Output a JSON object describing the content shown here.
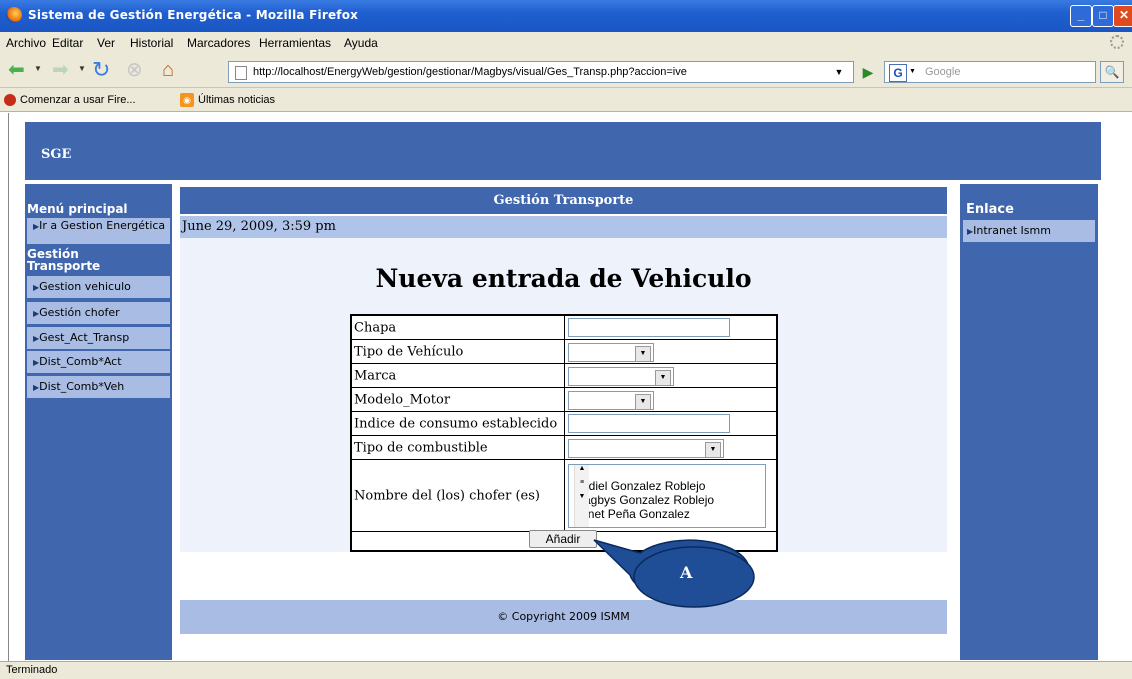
{
  "window": {
    "title": "Sistema de Gestión Energética - Mozilla Firefox"
  },
  "menu": [
    "Archivo",
    "Editar",
    "Ver",
    "Historial",
    "Marcadores",
    "Herramientas",
    "Ayuda"
  ],
  "toolbar": {
    "url": "http://localhost/EnergyWeb/gestion/gestionar/Magbys/visual/Ges_Transp.php?accion=ive",
    "search_placeholder": "Google",
    "search_engine_letter": "G"
  },
  "bookmarks": [
    "Comenzar a usar Fire...",
    "Últimas noticias"
  ],
  "header": {
    "site": "SGE"
  },
  "left_menu": {
    "title": "Menú principal",
    "top_item": "Ir a Gestion Energética",
    "section": "Gestión Transporte",
    "items": [
      "Gestion vehiculo",
      "Gestión chofer",
      "Gest_Act_Transp",
      "Dist_Comb*Act",
      "Dist_Comb*Veh"
    ]
  },
  "center": {
    "title": "Gestión Transporte",
    "date": "June 29, 2009, 3:59 pm",
    "page_title": "Nueva entrada de Vehiculo",
    "form": {
      "labels": [
        "Chapa",
        "Tipo de Vehículo",
        "Marca",
        "Modelo_Motor",
        "Indice de consumo establecido",
        "Tipo de combustible",
        "Nombre del (los) chofer (es)"
      ],
      "chofer_options": [
        "Abdiel Gonzalez Roblejo",
        "Magbys Gonzalez Roblejo",
        "Yanet Peña Gonzalez"
      ],
      "submit": "Añadir"
    },
    "footer": "© Copyright 2009 ISMM"
  },
  "right_menu": {
    "title": "Enlace",
    "items": [
      "Intranet Ismm"
    ]
  },
  "annotation": {
    "label": "A",
    "color": "#1f4e96"
  },
  "status": "Terminado",
  "colors": {
    "header_blue": "#4066ad",
    "light_blue": "#a9bde4",
    "date_bar": "#b0c4ea"
  }
}
